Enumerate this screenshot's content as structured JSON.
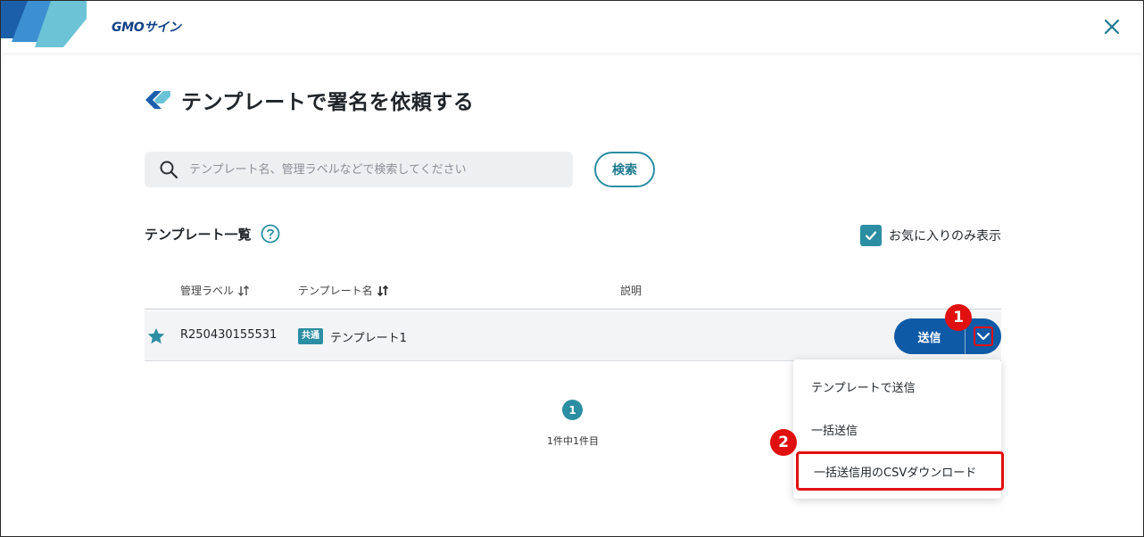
{
  "header": {
    "brand": "GMOサイン",
    "close_icon": "close-icon"
  },
  "page": {
    "title": "テンプレートで署名を依頼する"
  },
  "search": {
    "placeholder": "テンプレート名、管理ラベルなどで検索してください",
    "value": "",
    "button_label": "検索"
  },
  "list": {
    "title": "テンプレート一覧",
    "favorites_only_label": "お気に入りのみ表示",
    "favorites_only_checked": true,
    "columns": {
      "label": "管理ラベル",
      "name": "テンプレート名",
      "description": "説明"
    },
    "rows": [
      {
        "favorite": true,
        "label": "R250430155531",
        "badge": "共通",
        "name": "テンプレート1",
        "description": "",
        "send_label": "送信"
      }
    ]
  },
  "pagination": {
    "current_page": "1",
    "count_text": "1件中1件目"
  },
  "menu": {
    "items": [
      "テンプレートで送信",
      "一括送信",
      "一括送信用のCSVダウンロード"
    ]
  },
  "annotations": {
    "step1": "1",
    "step2": "2"
  },
  "colors": {
    "accent": "#2b8ea2",
    "primary_button": "#0f5aa6",
    "annotation_red": "#e01010"
  }
}
